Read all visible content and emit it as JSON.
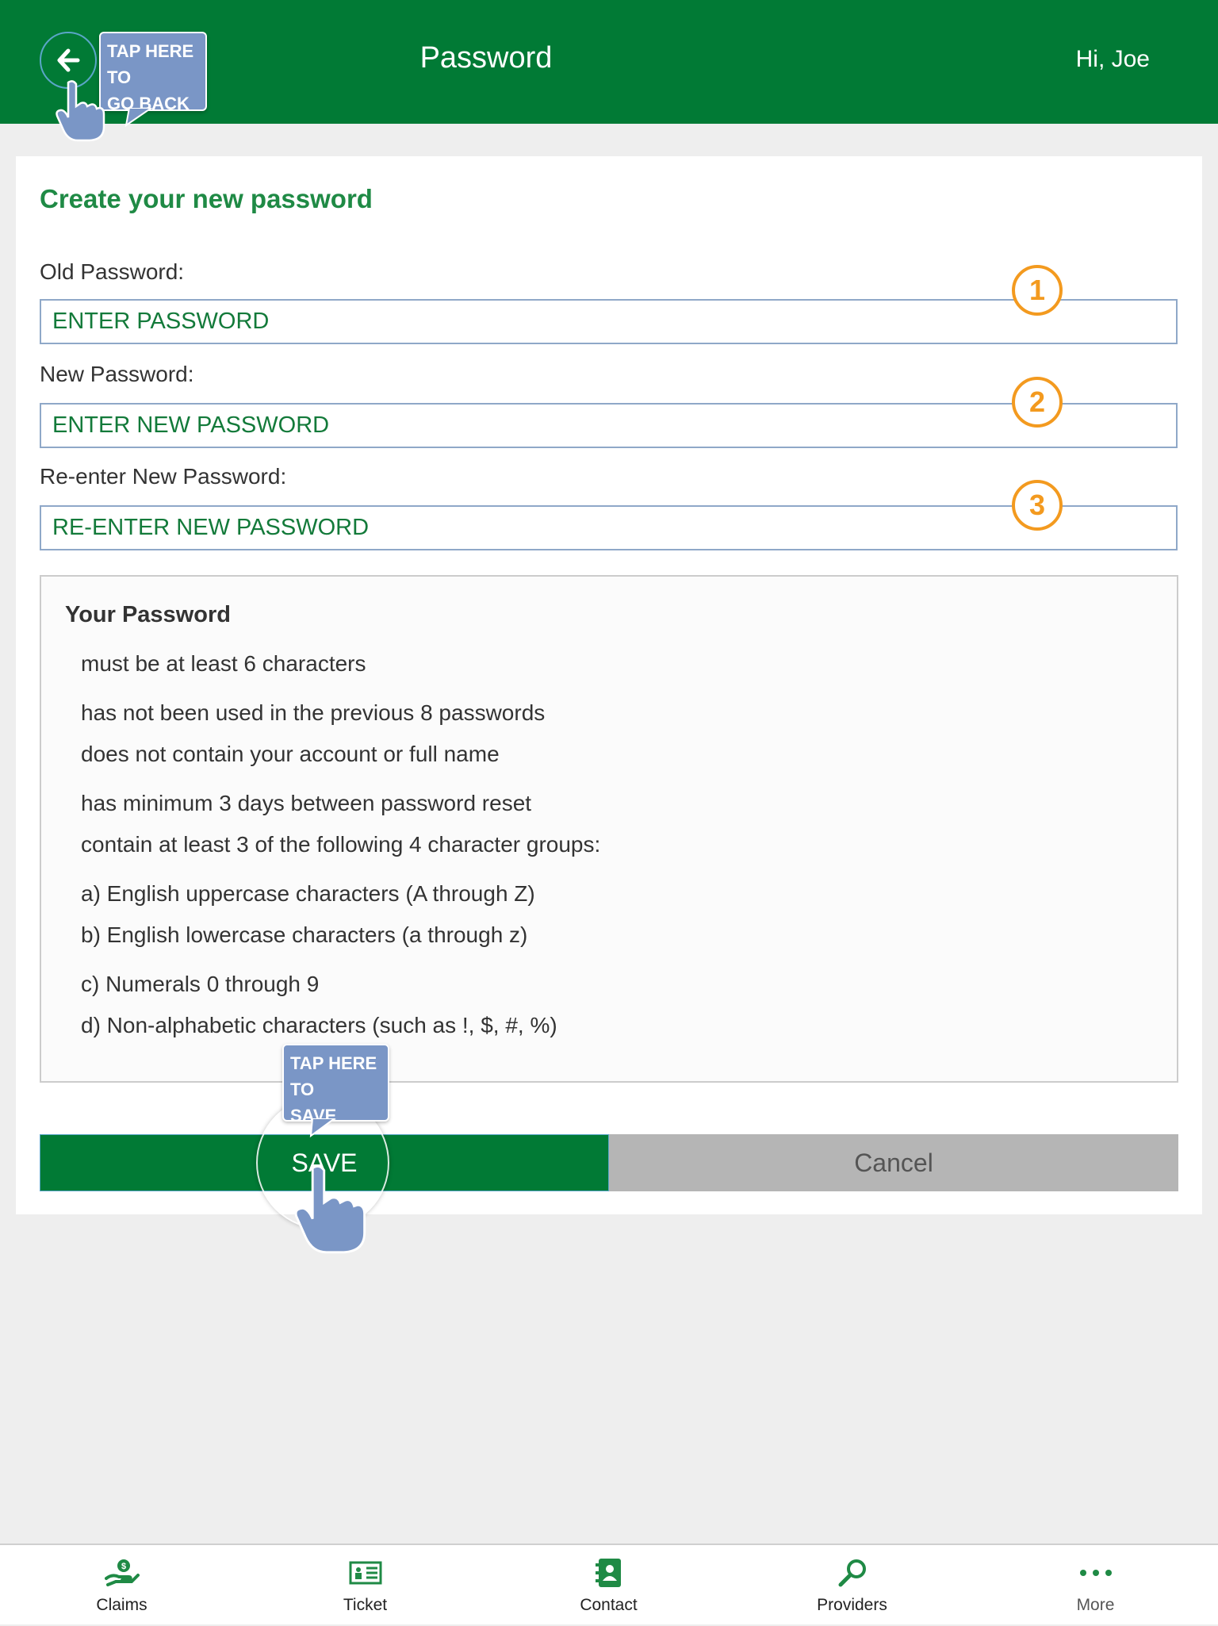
{
  "header": {
    "title": "Password",
    "greeting": "Hi, Joe"
  },
  "tooltips": {
    "back": [
      "TAP HERE TO",
      "GO BACK"
    ],
    "save": [
      "TAP HERE TO",
      "SAVE"
    ]
  },
  "form": {
    "heading": "Create your new password",
    "fields": [
      {
        "label": "Old Password:",
        "placeholder": "ENTER PASSWORD",
        "step": "1"
      },
      {
        "label": "New Password:",
        "placeholder": "ENTER NEW PASSWORD",
        "step": "2"
      },
      {
        "label": "Re-enter New Password:",
        "placeholder": "RE-ENTER NEW PASSWORD",
        "step": "3"
      }
    ]
  },
  "rules": {
    "title": "Your Password",
    "items": [
      "must be at least 6 characters",
      "has not been used in the previous 8 passwords",
      "does not contain your account or full name",
      "has minimum 3 days between password reset",
      "contain at least 3 of the following 4 character groups:",
      "a) English uppercase characters (A through Z)",
      "b) English lowercase characters (a through z)",
      "c) Numerals 0 through 9",
      "d) Non-alphabetic characters (such as !, $, #, %)"
    ]
  },
  "buttons": {
    "save": "SAVE",
    "cancel": "Cancel"
  },
  "tabbar": {
    "items": [
      {
        "label": "Claims",
        "icon": "claims-hand-coin-icon"
      },
      {
        "label": "Ticket",
        "icon": "ticket-icon"
      },
      {
        "label": "Contact",
        "icon": "contact-book-icon"
      },
      {
        "label": "Providers",
        "icon": "search-magnifier-icon"
      },
      {
        "label": "More",
        "icon": "more-dots-icon"
      }
    ]
  },
  "colors": {
    "brand_green": "#017a35",
    "accent_orange": "#f39a1f",
    "tooltip_blue": "#7a96c6",
    "cancel_grey": "#b5b5b5"
  }
}
